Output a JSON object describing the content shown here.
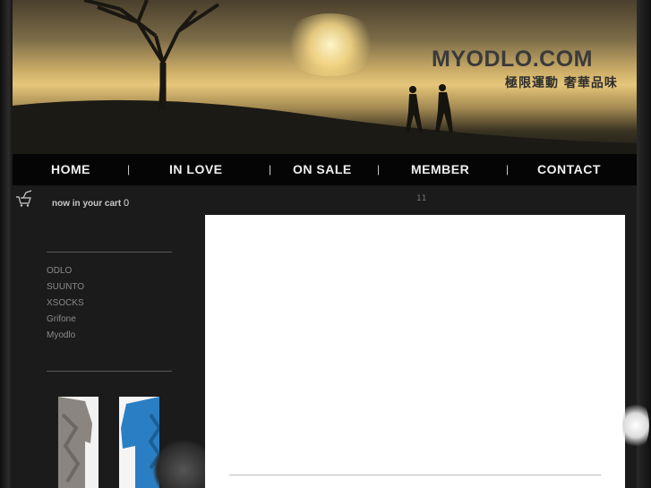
{
  "header": {
    "brand": "MYODLO.COM",
    "tagline": "極限運動 奢華品味"
  },
  "nav": {
    "items": [
      {
        "label": "HOME"
      },
      {
        "label": "IN LOVE"
      },
      {
        "label": "ON SALE"
      },
      {
        "label": "MEMBER"
      },
      {
        "label": "CONTACT"
      }
    ],
    "separator": "|"
  },
  "cart": {
    "label": "now in your cart",
    "count": "0"
  },
  "page_indicator": "11",
  "sidebar": {
    "brands": [
      "ODLO",
      "SUUNTO",
      "XSOCKS",
      "Grifone",
      "Myodlo"
    ]
  },
  "icons": {
    "cart": "shopping-cart-icon"
  },
  "colors": {
    "nav_background": "#050505",
    "sidebar_link": "#8a8a8a",
    "content_background": "#ffffff"
  }
}
